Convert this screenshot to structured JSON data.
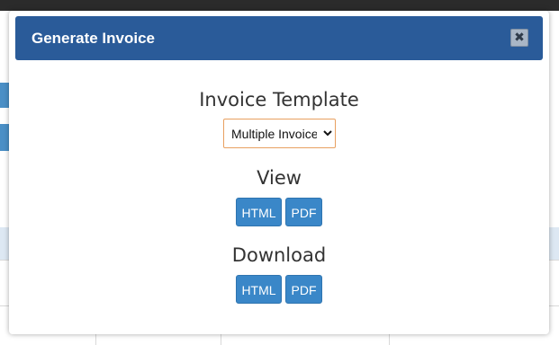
{
  "modal": {
    "title": "Generate Invoice",
    "close_icon": "close-icon"
  },
  "template": {
    "label": "Invoice Template",
    "selected": "Multiple Invoice"
  },
  "view": {
    "label": "View",
    "html_button": "HTML",
    "pdf_button": "PDF"
  },
  "download": {
    "label": "Download",
    "html_button": "HTML",
    "pdf_button": "PDF"
  },
  "colors": {
    "header_bg": "#2a5b99",
    "button_bg": "#3a87c8",
    "select_border": "#e8a060"
  }
}
